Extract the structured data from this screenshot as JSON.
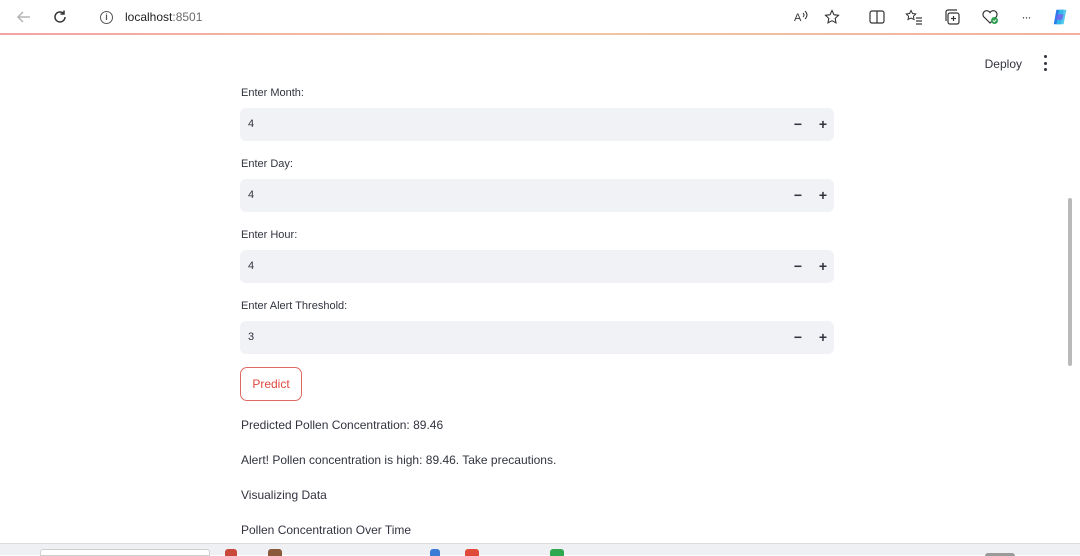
{
  "browser": {
    "url_host": "localhost",
    "url_port": ":8501",
    "read_aloud_label": "A͡",
    "more_label": "···"
  },
  "header": {
    "deploy_label": "Deploy"
  },
  "form": {
    "fields": [
      {
        "label": "Enter Month:",
        "value": "4"
      },
      {
        "label": "Enter Day:",
        "value": "4"
      },
      {
        "label": "Enter Hour:",
        "value": "4"
      },
      {
        "label": "Enter Alert Threshold:",
        "value": "3"
      }
    ],
    "minus_symbol": "−",
    "plus_symbol": "+",
    "predict_label": "Predict"
  },
  "results": {
    "prediction": "Predicted Pollen Concentration: 89.46",
    "alert": "Alert! Pollen concentration is high: 89.46. Take precautions.",
    "visualizing": "Visualizing Data",
    "chart_heading": "Pollen Concentration Over Time"
  },
  "icons": {
    "back": "back-arrow-icon",
    "reload": "reload-icon",
    "info": "info-icon",
    "read_aloud": "read-aloud-icon",
    "favorite": "star-icon",
    "split": "split-screen-icon",
    "favorites": "favorites-icon",
    "collections": "collections-icon",
    "health": "browser-essentials-icon",
    "more": "more-icon",
    "copilot": "copilot-icon"
  },
  "colors": {
    "accent": "#e0473e",
    "input_bg": "#f0f2f6",
    "text": "#31333f"
  }
}
